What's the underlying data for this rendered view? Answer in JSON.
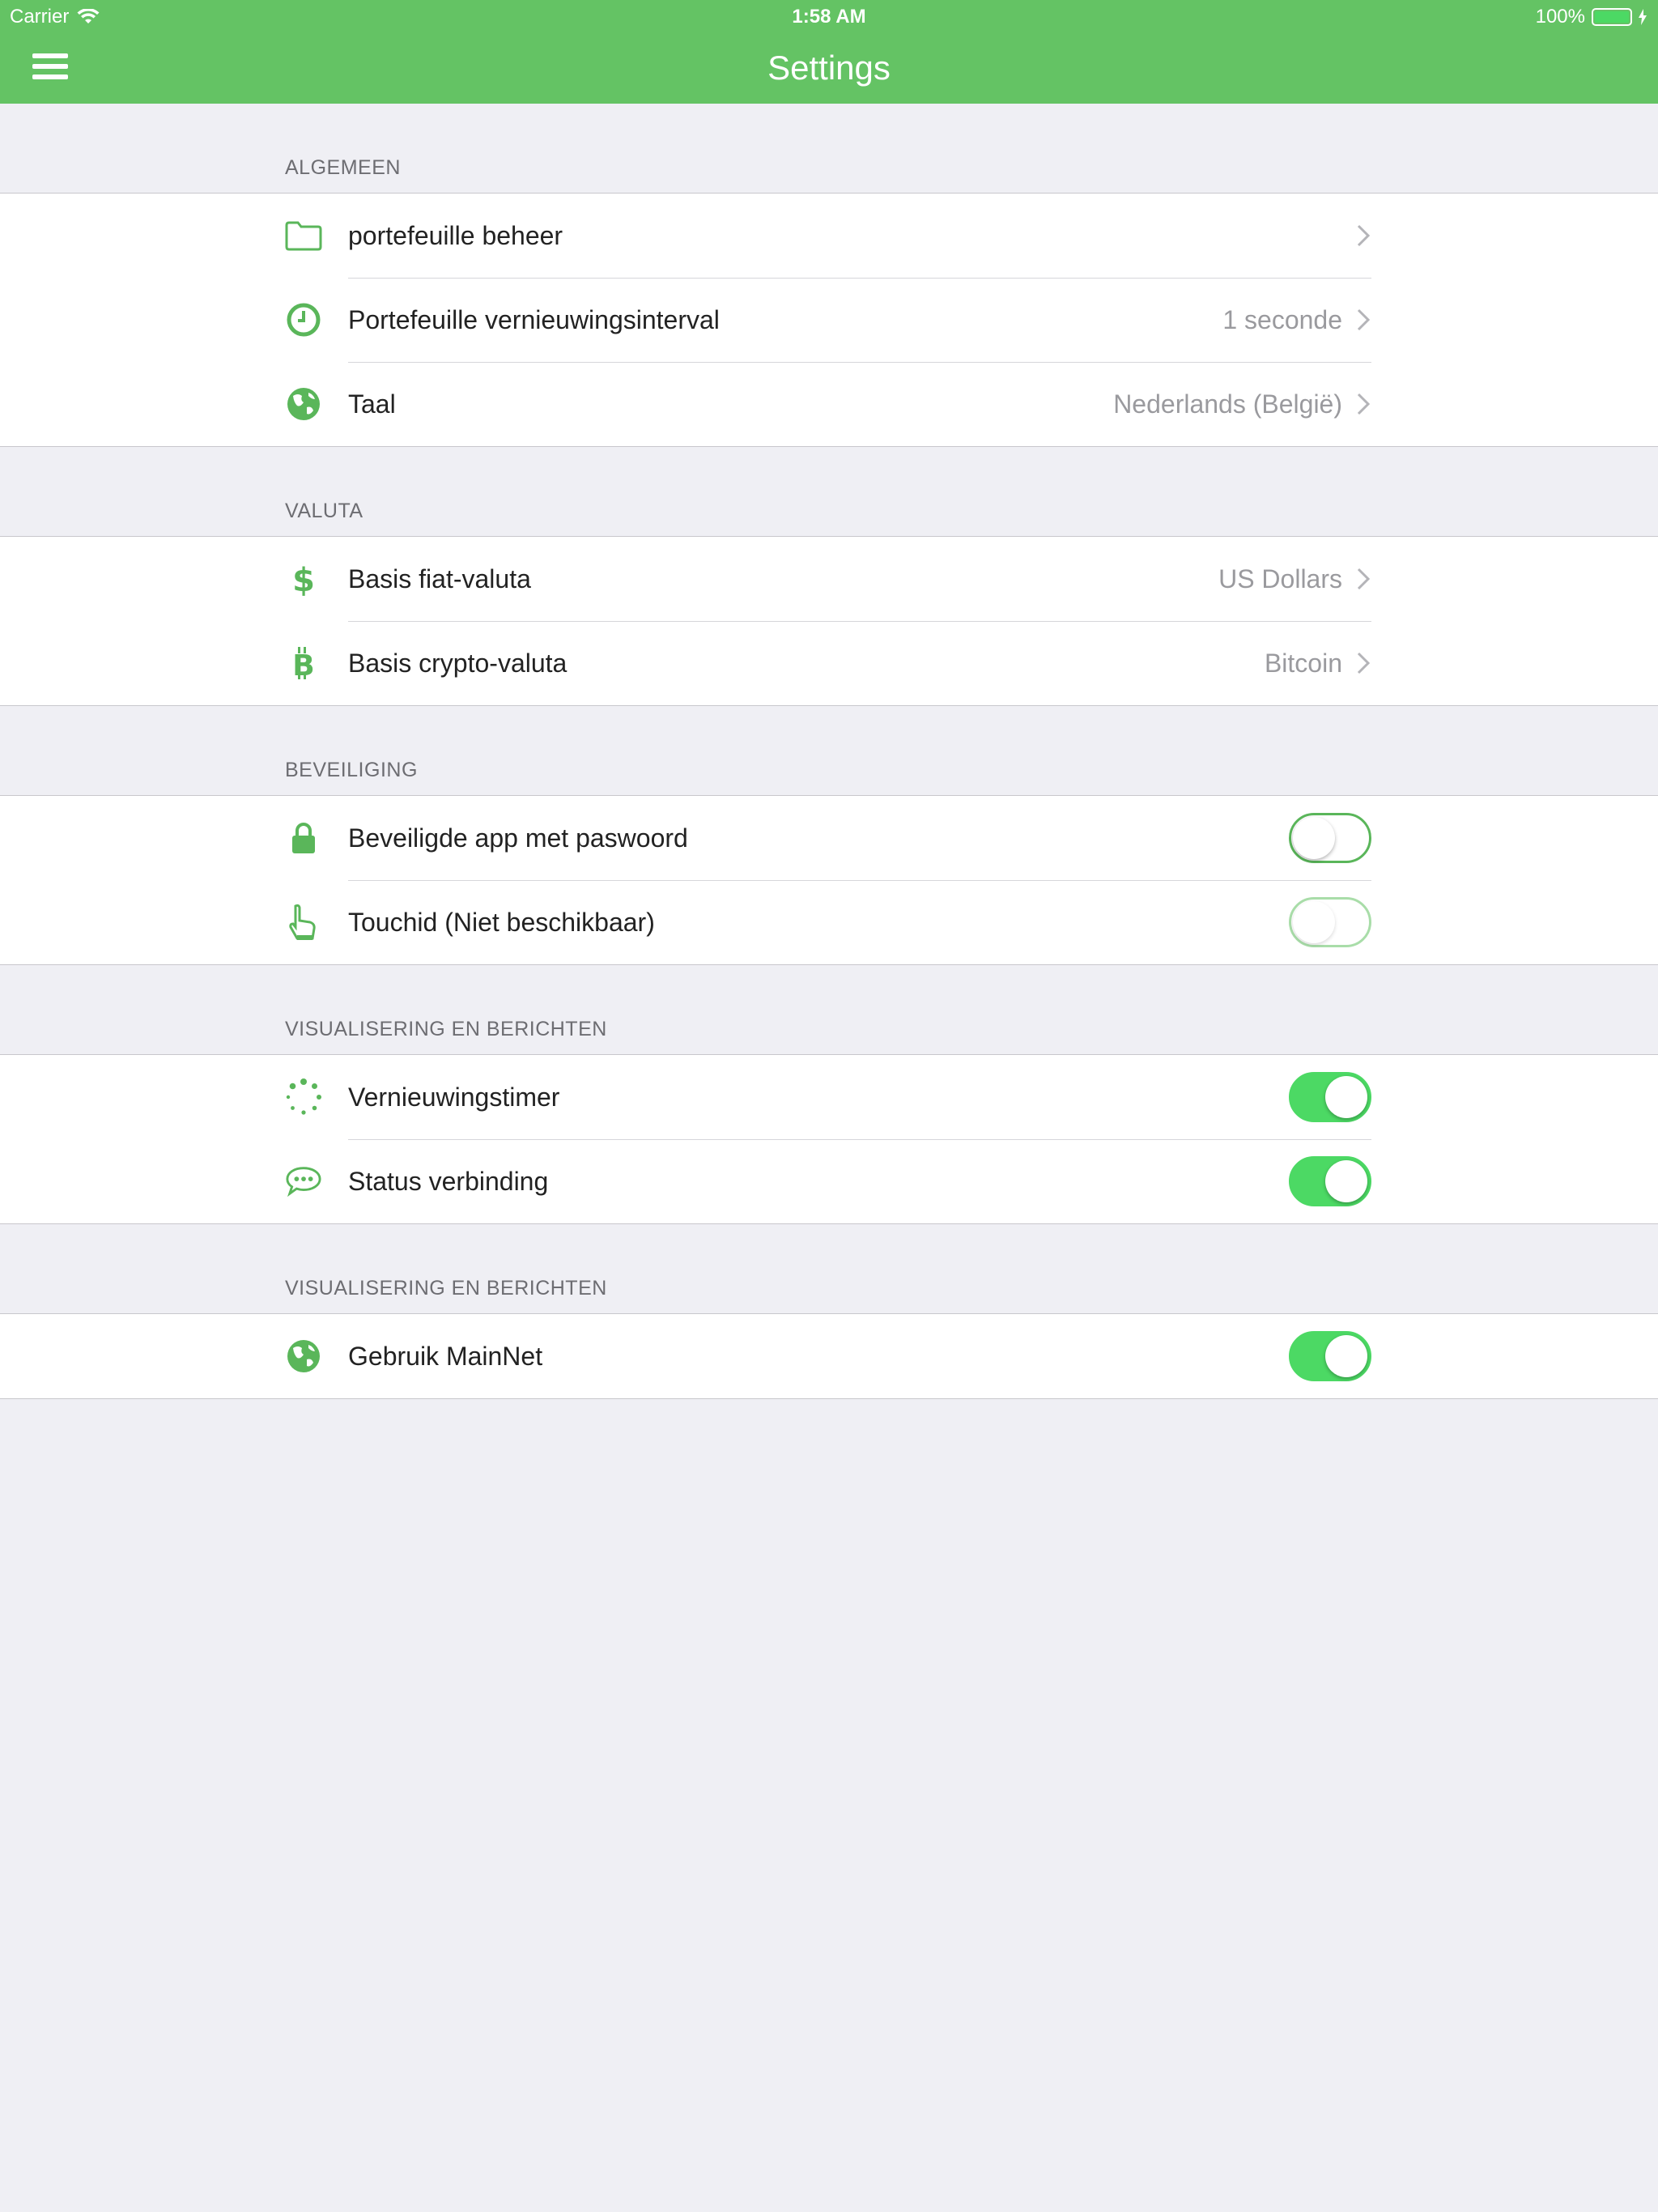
{
  "status_bar": {
    "carrier": "Carrier",
    "time": "1:58 AM",
    "battery": "100%"
  },
  "nav": {
    "title": "Settings"
  },
  "colors": {
    "accent": "#64c364",
    "toggle_on": "#4cd964",
    "background": "#efeff4"
  },
  "sections": {
    "algemeen": {
      "header": "ALGEMEEN",
      "items": [
        {
          "label": "portefeuille beheer",
          "value": "",
          "icon": "folder-icon"
        },
        {
          "label": "Portefeuille vernieuwingsinterval",
          "value": "1 seconde",
          "icon": "clock-icon"
        },
        {
          "label": "Taal",
          "value": "Nederlands (België)",
          "icon": "globe-icon"
        }
      ]
    },
    "valuta": {
      "header": "VALUTA",
      "items": [
        {
          "label": "Basis fiat-valuta",
          "value": "US Dollars",
          "icon": "dollar-icon"
        },
        {
          "label": "Basis crypto-valuta",
          "value": "Bitcoin",
          "icon": "bitcoin-icon"
        }
      ]
    },
    "beveiliging": {
      "header": "BEVEILIGING",
      "items": [
        {
          "label": "Beveiligde app met paswoord",
          "toggle": "off",
          "icon": "lock-icon"
        },
        {
          "label": "Touchid (Niet beschikbaar)",
          "toggle": "off-disabled",
          "icon": "finger-icon"
        }
      ]
    },
    "visualisering": {
      "header": "VISUALISERING EN BERICHTEN",
      "items": [
        {
          "label": "Vernieuwingstimer",
          "toggle": "on",
          "icon": "spinner-icon"
        },
        {
          "label": "Status verbinding",
          "toggle": "on",
          "icon": "chat-bubble-icon"
        }
      ]
    },
    "netwerk": {
      "header": "VISUALISERING EN BERICHTEN",
      "items": [
        {
          "label": "Gebruik MainNet",
          "toggle": "on",
          "icon": "globe-icon"
        }
      ]
    }
  }
}
